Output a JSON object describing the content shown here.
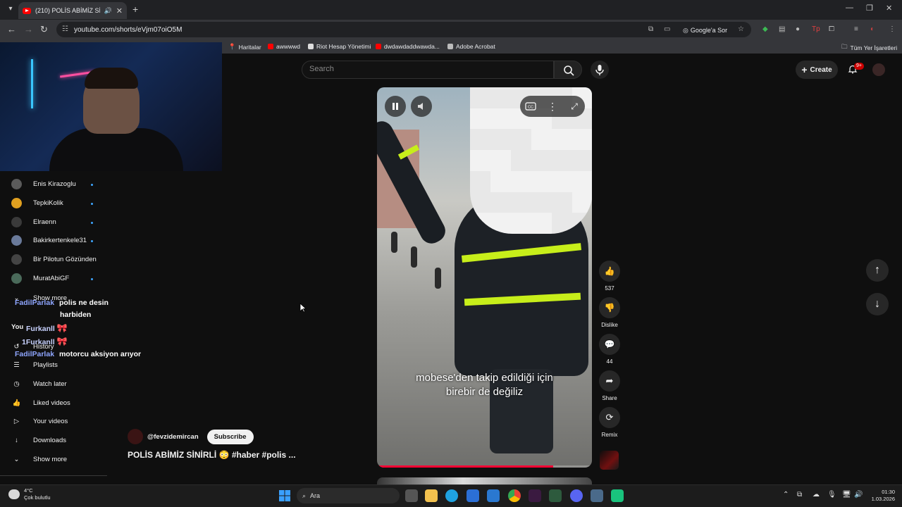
{
  "browser": {
    "tab_title": "(210) POLİS ABİMİZ SİNİRLİ",
    "url": "youtube.com/shorts/eVjm07oiO5M",
    "ask_google": "Google'a Sor",
    "bookmarks": [
      "Haritalar",
      "awwwwd",
      "Riot Hesap Yönetimi",
      "dwdawdaddwawda...",
      "Adobe Acrobat"
    ],
    "all_bookmarks": "Tüm Yer İşaretleri"
  },
  "youtube": {
    "search_placeholder": "Search",
    "create_label": "Create",
    "notification_count": "9+"
  },
  "sidebar": {
    "subscriptions": [
      {
        "name": "Enis Kirazoglu",
        "color": "#5a5a5a"
      },
      {
        "name": "TepkiKolik",
        "color": "#e0a020"
      },
      {
        "name": "Elraenn",
        "color": "#3a3a3a"
      },
      {
        "name": "Bakirkertenkele31",
        "color": "#6a7a9a"
      },
      {
        "name": "Bir Pilotun Gözünden",
        "color": "#444444"
      },
      {
        "name": "MuratAbiGF",
        "color": "#4a6a5a"
      }
    ],
    "show_more": "Show more",
    "you_label": "You",
    "history": "History",
    "items": [
      "Playlists",
      "Watch later",
      "Liked videos",
      "Your videos",
      "Downloads"
    ],
    "show_more_bottom": "Show more"
  },
  "chat": [
    {
      "user": "FadilParlak",
      "message": "polis ne desin",
      "message2": "harbiden"
    },
    {
      "user": "Furkanll",
      "message": ""
    },
    {
      "user": "1Furkanll",
      "message": ""
    },
    {
      "user": "FadilParlak",
      "message": "motorcu aksiyon arıyor"
    }
  ],
  "video": {
    "caption_line1": "mobese'den takip edildiği için",
    "caption_line2": "birebir de değiliz",
    "progress": 0.82,
    "channel_handle": "@fevzidemircan",
    "subscribe_label": "Subscribe",
    "title": "POLİS ABİMİZ SİNİRLİ 😳 #haber #polis ..."
  },
  "actions": {
    "like_count": "537",
    "dislike_label": "Dislike",
    "comment_count": "44",
    "share_label": "Share",
    "remix_label": "Remix"
  },
  "taskbar": {
    "temperature": "4°C",
    "weather": "Çok bulutlu",
    "search_placeholder": "Ara",
    "time": "01:30",
    "date": "1.03.2026"
  }
}
